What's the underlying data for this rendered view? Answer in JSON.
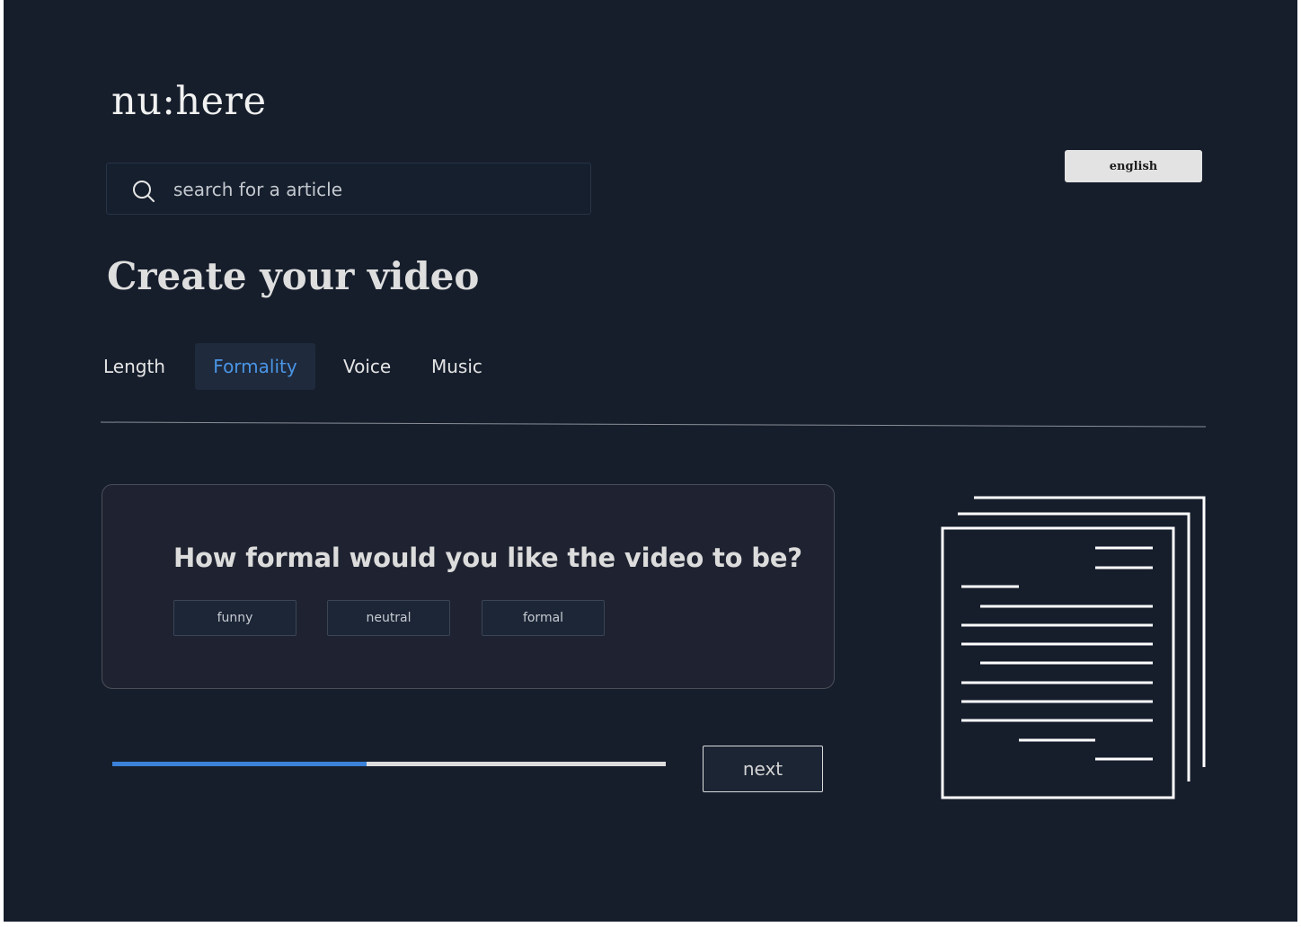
{
  "app": {
    "logo": "nu:here"
  },
  "language": {
    "label": "english"
  },
  "search": {
    "placeholder": "search for a article"
  },
  "page": {
    "title": "Create your video"
  },
  "tabs": [
    {
      "label": "Length",
      "active": false
    },
    {
      "label": "Formality",
      "active": true
    },
    {
      "label": "Voice",
      "active": false
    },
    {
      "label": "Music",
      "active": false
    }
  ],
  "question": {
    "text": "How formal would you like the video to be?",
    "options": [
      "funny",
      "neutral",
      "formal"
    ]
  },
  "progress": {
    "fraction": 0.46
  },
  "navigation": {
    "next_label": "next"
  },
  "icons": {
    "search": "search-icon",
    "illustration": "document-stack-icon"
  },
  "colors": {
    "background": "#161e2c",
    "accent": "#3b82d8",
    "active_tab_text": "#4a95e6",
    "card_background": "#1f2331"
  }
}
